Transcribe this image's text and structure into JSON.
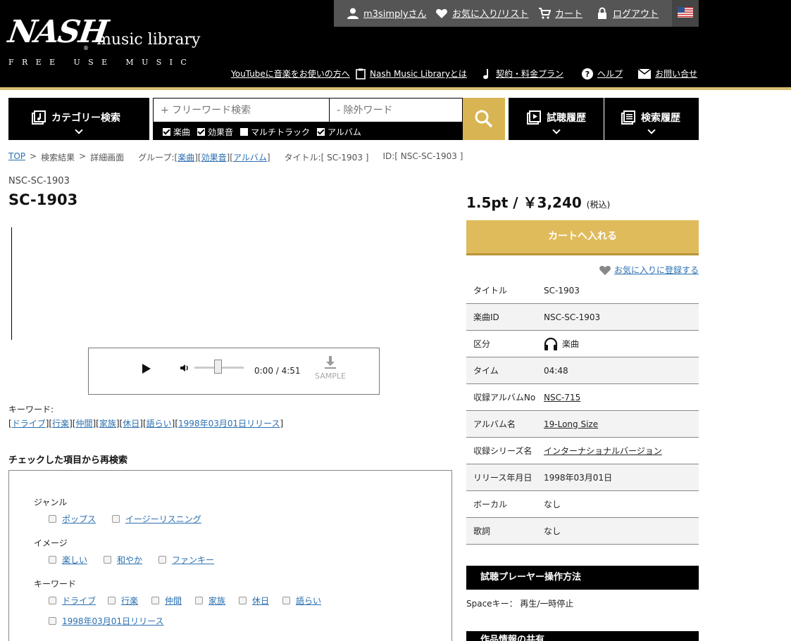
{
  "brand": {
    "mark": "NASH",
    "name": "music library",
    "tagline": "FREE USE MUSIC"
  },
  "topbar": {
    "user": "m3simplyさん",
    "favorites": "お気に入り/リスト",
    "cart": "カート",
    "logout": "ログアウト"
  },
  "subnav": {
    "youtube": "YouTubeに音楽をお使いの方へ",
    "about": "Nash Music Libraryとは",
    "pricing": "契約・料金プラン",
    "help": "ヘルプ",
    "contact": "お問い合せ"
  },
  "search": {
    "category_label": "カテゴリー検索",
    "free_placeholder": "+ フリーワード検索",
    "exclude_placeholder": "- 除外ワード",
    "filters": [
      {
        "label": "楽曲",
        "checked": true
      },
      {
        "label": "効果音",
        "checked": true
      },
      {
        "label": "マルチトラック",
        "checked": false
      },
      {
        "label": "アルバム",
        "checked": true
      }
    ],
    "listen_history": "試聴履歴",
    "search_history": "検索履歴"
  },
  "breadcrumb": {
    "top": "TOP",
    "results": "検索結果",
    "detail": "詳細画面",
    "group_prefix": "グループ:",
    "groups": [
      "楽曲",
      "効果音",
      "アルバム"
    ],
    "title_part": "タイトル:[ SC-1903 ]",
    "id_part": "ID:[ NSC-SC-1903 ]"
  },
  "track": {
    "id": "NSC-SC-1903",
    "title": "SC-1903"
  },
  "player": {
    "time": "0:00 / 4:51",
    "sample_label": "SAMPLE",
    "volume": 0.5
  },
  "keywords": {
    "label": "キーワード:",
    "items": [
      "ドライブ",
      "行楽",
      "仲間",
      "家族",
      "休日",
      "語らい",
      "1998年03月01日リリース"
    ]
  },
  "recheck": {
    "title": "チェックした項目から再検索",
    "groups": [
      {
        "label": "ジャンル",
        "options": [
          "ポップス",
          "イージーリスニング"
        ]
      },
      {
        "label": "イメージ",
        "options": [
          "楽しい",
          "和やか",
          "ファンキー"
        ]
      },
      {
        "label": "キーワード",
        "options": [
          "ドライブ",
          "行楽",
          "仲間",
          "家族",
          "休日",
          "語らい",
          "1998年03月01日リリース"
        ]
      }
    ]
  },
  "price": {
    "main": "1.5pt / ￥3,240",
    "tax": "(税込)"
  },
  "cart_button": "カートへ入れる",
  "favorite_link": "お気に入りに登録する",
  "info": [
    {
      "key": "タイトル",
      "value": "SC-1903"
    },
    {
      "key": "楽曲ID",
      "value": "NSC-SC-1903"
    },
    {
      "key": "区分",
      "value": "楽曲"
    },
    {
      "key": "タイム",
      "value": "04:48"
    },
    {
      "key": "収録アルバムNo",
      "value": "NSC-715"
    },
    {
      "key": "アルバム名",
      "value": "19-Long Size"
    },
    {
      "key": "収録シリーズ名",
      "value": "インターナショナルバージョン"
    },
    {
      "key": "リリース年月日",
      "value": "1998年03月01日"
    },
    {
      "key": "ボーカル",
      "value": "なし"
    },
    {
      "key": "歌詞",
      "value": "なし"
    }
  ],
  "guide": {
    "title": "試聴プレーヤー操作方法",
    "text": "Spaceキー： 再生/一時停止"
  },
  "share": {
    "title": "作品情報の共有"
  }
}
